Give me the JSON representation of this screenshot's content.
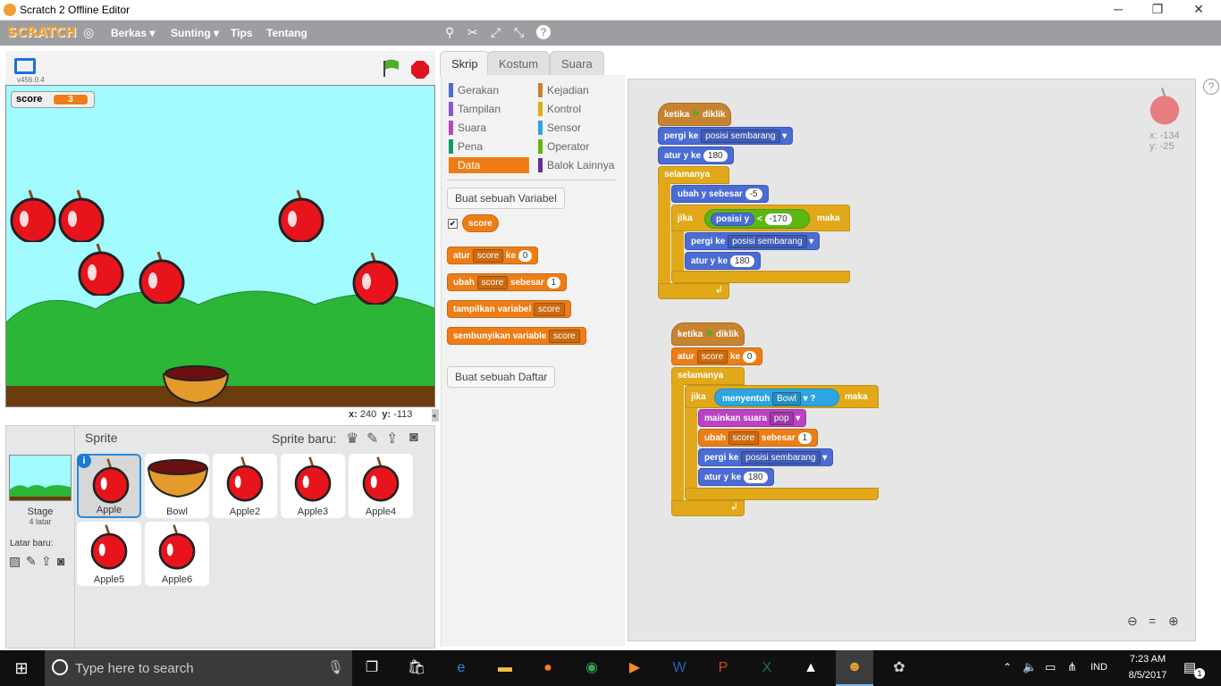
{
  "window": {
    "title": "Scratch 2 Offline Editor",
    "minimize": "─",
    "maximize": "❐",
    "close": "✕"
  },
  "menubar": {
    "logo": "SCRATCH",
    "items": [
      "Berkas ▾",
      "Sunting ▾",
      "Tips",
      "Tentang"
    ]
  },
  "stage": {
    "version": "v456.0.4",
    "variable_name": "score",
    "variable_value": "3",
    "coords_x_label": "x:",
    "coords_x": "240",
    "coords_y_label": "y:",
    "coords_y": "-113"
  },
  "sprites": {
    "header": "Sprite",
    "new_sprite_label": "Sprite baru:",
    "stage_label": "Stage",
    "stage_backdrops": "4 latar",
    "new_backdrop_label": "Latar baru:",
    "items": [
      "Apple",
      "Bowl",
      "Apple2",
      "Apple3",
      "Apple4",
      "Apple5",
      "Apple6"
    ]
  },
  "tabs": [
    "Skrip",
    "Kostum",
    "Suara"
  ],
  "categories": {
    "left": [
      "Gerakan",
      "Tampilan",
      "Suara",
      "Pena",
      "Data"
    ],
    "right": [
      "Kejadian",
      "Kontrol",
      "Sensor",
      "Operator",
      "Balok Lainnya"
    ],
    "active": "Data"
  },
  "palette": {
    "make_variable": "Buat sebuah Variabel",
    "variable": "score",
    "set_block": {
      "verb": "atur",
      "var": "score",
      "to": "ke",
      "value": "0"
    },
    "change_block": {
      "verb": "ubah",
      "var": "score",
      "by": "sebesar",
      "value": "1"
    },
    "show_block": {
      "verb": "tampilkan variabel",
      "var": "score"
    },
    "hide_block": {
      "verb": "sembunyikan variable",
      "var": "score"
    },
    "make_list": "Buat sebuah Daftar"
  },
  "script1": {
    "hat": "ketika",
    "hat2": "diklik",
    "goto": "pergi ke",
    "goto_target": "posisi sembarang",
    "sety": "atur y ke",
    "sety_val": "180",
    "forever": "selamanya",
    "changey": "ubah y sebesar",
    "changey_val": "-5",
    "if": "jika",
    "then": "maka",
    "ypos": "posisi y",
    "lt": "<",
    "lt_val": "-170",
    "goto2": "pergi ke",
    "goto2_target": "posisi sembarang",
    "sety2": "atur y ke",
    "sety2_val": "180"
  },
  "script2": {
    "hat": "ketika",
    "hat2": "diklik",
    "set": "atur",
    "set_var": "score",
    "set_to": "ke",
    "set_val": "0",
    "forever": "selamanya",
    "if": "jika",
    "touching": "menyentuh",
    "touching_target": "Bowl",
    "q": "?",
    "then": "maka",
    "play": "mainkan suara",
    "play_sound": "pop",
    "change": "ubah",
    "change_var": "score",
    "change_by": "sebesar",
    "change_val": "1",
    "goto": "pergi ke",
    "goto_target": "posisi sembarang",
    "sety": "atur y ke",
    "sety_val": "180"
  },
  "sprite_info": {
    "x_label": "x:",
    "x": "-134",
    "y_label": "y:",
    "y": "-25"
  },
  "taskbar": {
    "search_placeholder": "Type here to search",
    "language": "IND",
    "time": "7:23 AM",
    "date": "8/5/2017",
    "notifications": "1"
  }
}
